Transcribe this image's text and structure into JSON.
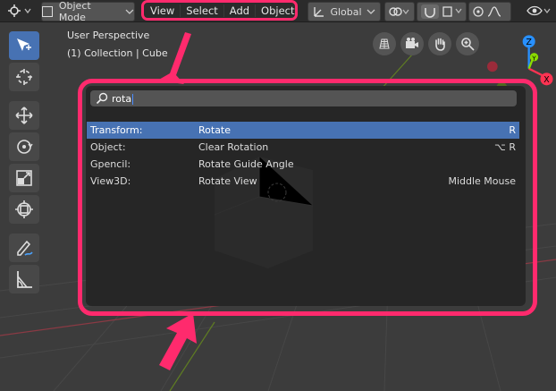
{
  "header": {
    "mode_label": "Object Mode",
    "menu": [
      "View",
      "Select",
      "Add",
      "Object"
    ],
    "transform_orientation": "Global"
  },
  "viewport": {
    "perspective_label": "User Perspective",
    "collection_label": "(1) Collection | Cube"
  },
  "search": {
    "query": "rota"
  },
  "results": [
    {
      "category": "Transform:",
      "operator": "Rotate",
      "shortcut": "R",
      "selected": true
    },
    {
      "category": "Object:",
      "operator": "Clear Rotation",
      "shortcut": "⌥ R",
      "selected": false
    },
    {
      "category": "Gpencil:",
      "operator": "Rotate Guide Angle",
      "shortcut": "",
      "selected": false
    },
    {
      "category": "View3D:",
      "operator": "Rotate View",
      "shortcut": "Middle Mouse",
      "selected": false
    }
  ],
  "gizmo": {
    "z": "Z",
    "y": "Y",
    "x": "X"
  },
  "colors": {
    "highlight": "#ff2a6d",
    "selection": "#4772b3",
    "axis_x": "#ff3352",
    "axis_y": "#8bdc00",
    "axis_z": "#2890ff"
  },
  "tools": [
    "select-box-icon",
    "cursor-icon",
    "move-icon",
    "rotate-icon",
    "scale-icon",
    "transform-icon",
    "annotate-icon",
    "measure-icon"
  ]
}
